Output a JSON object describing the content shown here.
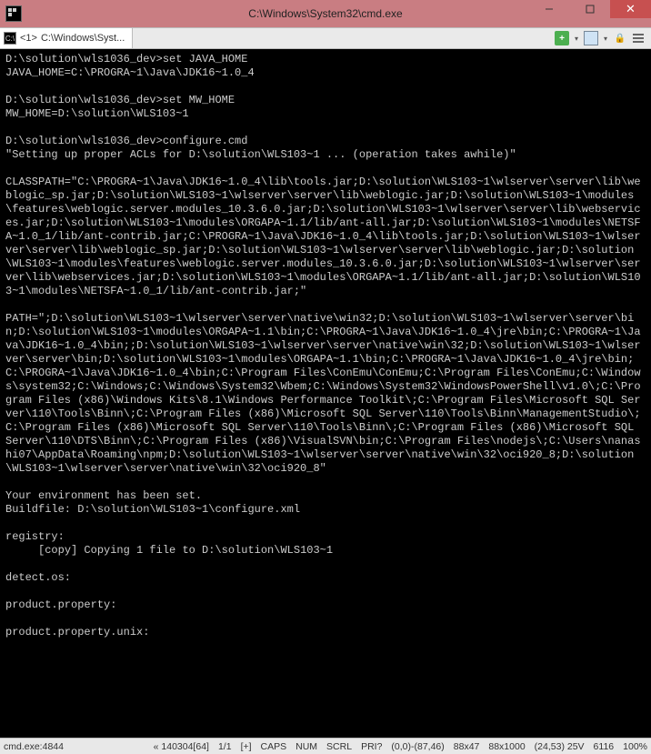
{
  "titlebar": {
    "title": "C:\\Windows\\System32\\cmd.exe"
  },
  "tab": {
    "index": "<1>",
    "label": "C:\\Windows\\Syst..."
  },
  "terminal": {
    "content": "D:\\solution\\wls1036_dev>set JAVA_HOME\nJAVA_HOME=C:\\PROGRA~1\\Java\\JDK16~1.0_4\n\nD:\\solution\\wls1036_dev>set MW_HOME\nMW_HOME=D:\\solution\\WLS103~1\n\nD:\\solution\\wls1036_dev>configure.cmd\n\"Setting up proper ACLs for D:\\solution\\WLS103~1 ... (operation takes awhile)\"\n\nCLASSPATH=\"C:\\PROGRA~1\\Java\\JDK16~1.0_4\\lib\\tools.jar;D:\\solution\\WLS103~1\\wlserver\\server\\lib\\weblogic_sp.jar;D:\\solution\\WLS103~1\\wlserver\\server\\lib\\weblogic.jar;D:\\solution\\WLS103~1\\modules\\features\\weblogic.server.modules_10.3.6.0.jar;D:\\solution\\WLS103~1\\wlserver\\server\\lib\\webservices.jar;D:\\solution\\WLS103~1\\modules\\ORGAPA~1.1/lib/ant-all.jar;D:\\solution\\WLS103~1\\modules\\NETSFA~1.0_1/lib/ant-contrib.jar;C:\\PROGRA~1\\Java\\JDK16~1.0_4\\lib\\tools.jar;D:\\solution\\WLS103~1\\wlserver\\server\\lib\\weblogic_sp.jar;D:\\solution\\WLS103~1\\wlserver\\server\\lib\\weblogic.jar;D:\\solution\\WLS103~1\\modules\\features\\weblogic.server.modules_10.3.6.0.jar;D:\\solution\\WLS103~1\\wlserver\\server\\lib\\webservices.jar;D:\\solution\\WLS103~1\\modules\\ORGAPA~1.1/lib/ant-all.jar;D:\\solution\\WLS103~1\\modules\\NETSFA~1.0_1/lib/ant-contrib.jar;\"\n\nPATH=\";D:\\solution\\WLS103~1\\wlserver\\server\\native\\win32;D:\\solution\\WLS103~1\\wlserver\\server\\bin;D:\\solution\\WLS103~1\\modules\\ORGAPA~1.1\\bin;C:\\PROGRA~1\\Java\\JDK16~1.0_4\\jre\\bin;C:\\PROGRA~1\\Java\\JDK16~1.0_4\\bin;;D:\\solution\\WLS103~1\\wlserver\\server\\native\\win\\32;D:\\solution\\WLS103~1\\wlserver\\server\\bin;D:\\solution\\WLS103~1\\modules\\ORGAPA~1.1\\bin;C:\\PROGRA~1\\Java\\JDK16~1.0_4\\jre\\bin;C:\\PROGRA~1\\Java\\JDK16~1.0_4\\bin;C:\\Program Files\\ConEmu\\ConEmu;C:\\Program Files\\ConEmu;C:\\Windows\\system32;C:\\Windows;C:\\Windows\\System32\\Wbem;C:\\Windows\\System32\\WindowsPowerShell\\v1.0\\;C:\\Program Files (x86)\\Windows Kits\\8.1\\Windows Performance Toolkit\\;C:\\Program Files\\Microsoft SQL Server\\110\\Tools\\Binn\\;C:\\Program Files (x86)\\Microsoft SQL Server\\110\\Tools\\Binn\\ManagementStudio\\;C:\\Program Files (x86)\\Microsoft SQL Server\\110\\Tools\\Binn\\;C:\\Program Files (x86)\\Microsoft SQL Server\\110\\DTS\\Binn\\;C:\\Program Files (x86)\\VisualSVN\\bin;C:\\Program Files\\nodejs\\;C:\\Users\\nanashi07\\AppData\\Roaming\\npm;D:\\solution\\WLS103~1\\wlserver\\server\\native\\win\\32\\oci920_8;D:\\solution\\WLS103~1\\wlserver\\server\\native\\win\\32\\oci920_8\"\n\nYour environment has been set.\nBuildfile: D:\\solution\\WLS103~1\\configure.xml\n\nregistry:\n     [copy] Copying 1 file to D:\\solution\\WLS103~1\n\ndetect.os:\n\nproduct.property:\n\nproduct.property.unix:"
  },
  "status": {
    "proc": "cmd.exe:4844",
    "chars": "« 140304[64]",
    "lines": "1/1",
    "mode": "[+]",
    "caps": "CAPS",
    "num": "NUM",
    "scrl": "SCRL",
    "pri": "PRI?",
    "cursor": "(0,0)-(87,46)",
    "size": "88x47",
    "consize": "88x1000",
    "cell": "(24,53) 25V",
    "buf": "6116",
    "pct": "100%"
  }
}
